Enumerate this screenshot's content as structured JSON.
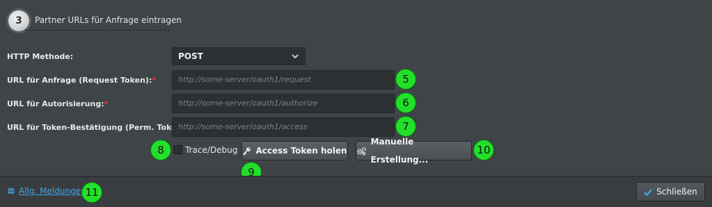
{
  "step": {
    "number": "3",
    "title": "Partner URLs für Anfrage eintragen"
  },
  "form": {
    "http_method": {
      "label": "HTTP Methode:",
      "value": "POST"
    },
    "request_url": {
      "label": "URL für Anfrage (Request Token):",
      "required": "*",
      "placeholder": "http://some-server/oauth1/request"
    },
    "authorize_url": {
      "label": "URL für Autorisierung:",
      "required": "*",
      "placeholder": "http://some-server/oauth1/authorize"
    },
    "access_url": {
      "label": "URL für Token-Bestätigung (Perm. Token):",
      "required": "*",
      "placeholder": "http://some-server/oauth1/access"
    },
    "trace_debug": {
      "label": "Trace/Debug",
      "checked": false
    }
  },
  "buttons": {
    "access_token": "Access Token holen",
    "manual": "Manuelle Erstellung..."
  },
  "footer": {
    "messages_link": "Allg. Meldungen",
    "close_label": "Schließen"
  },
  "badges": [
    "5",
    "6",
    "7",
    "8",
    "9",
    "10",
    "11"
  ],
  "colors": {
    "badge": "#22e02a",
    "link": "#3ea7e6",
    "required": "#e63b3b",
    "check": "#3ea7e6"
  },
  "icons": {
    "select": "chevron-down-icon",
    "access_token": "key-icon",
    "manual": "gears-icon",
    "messages": "globe-icon",
    "close": "checkmark-icon"
  }
}
